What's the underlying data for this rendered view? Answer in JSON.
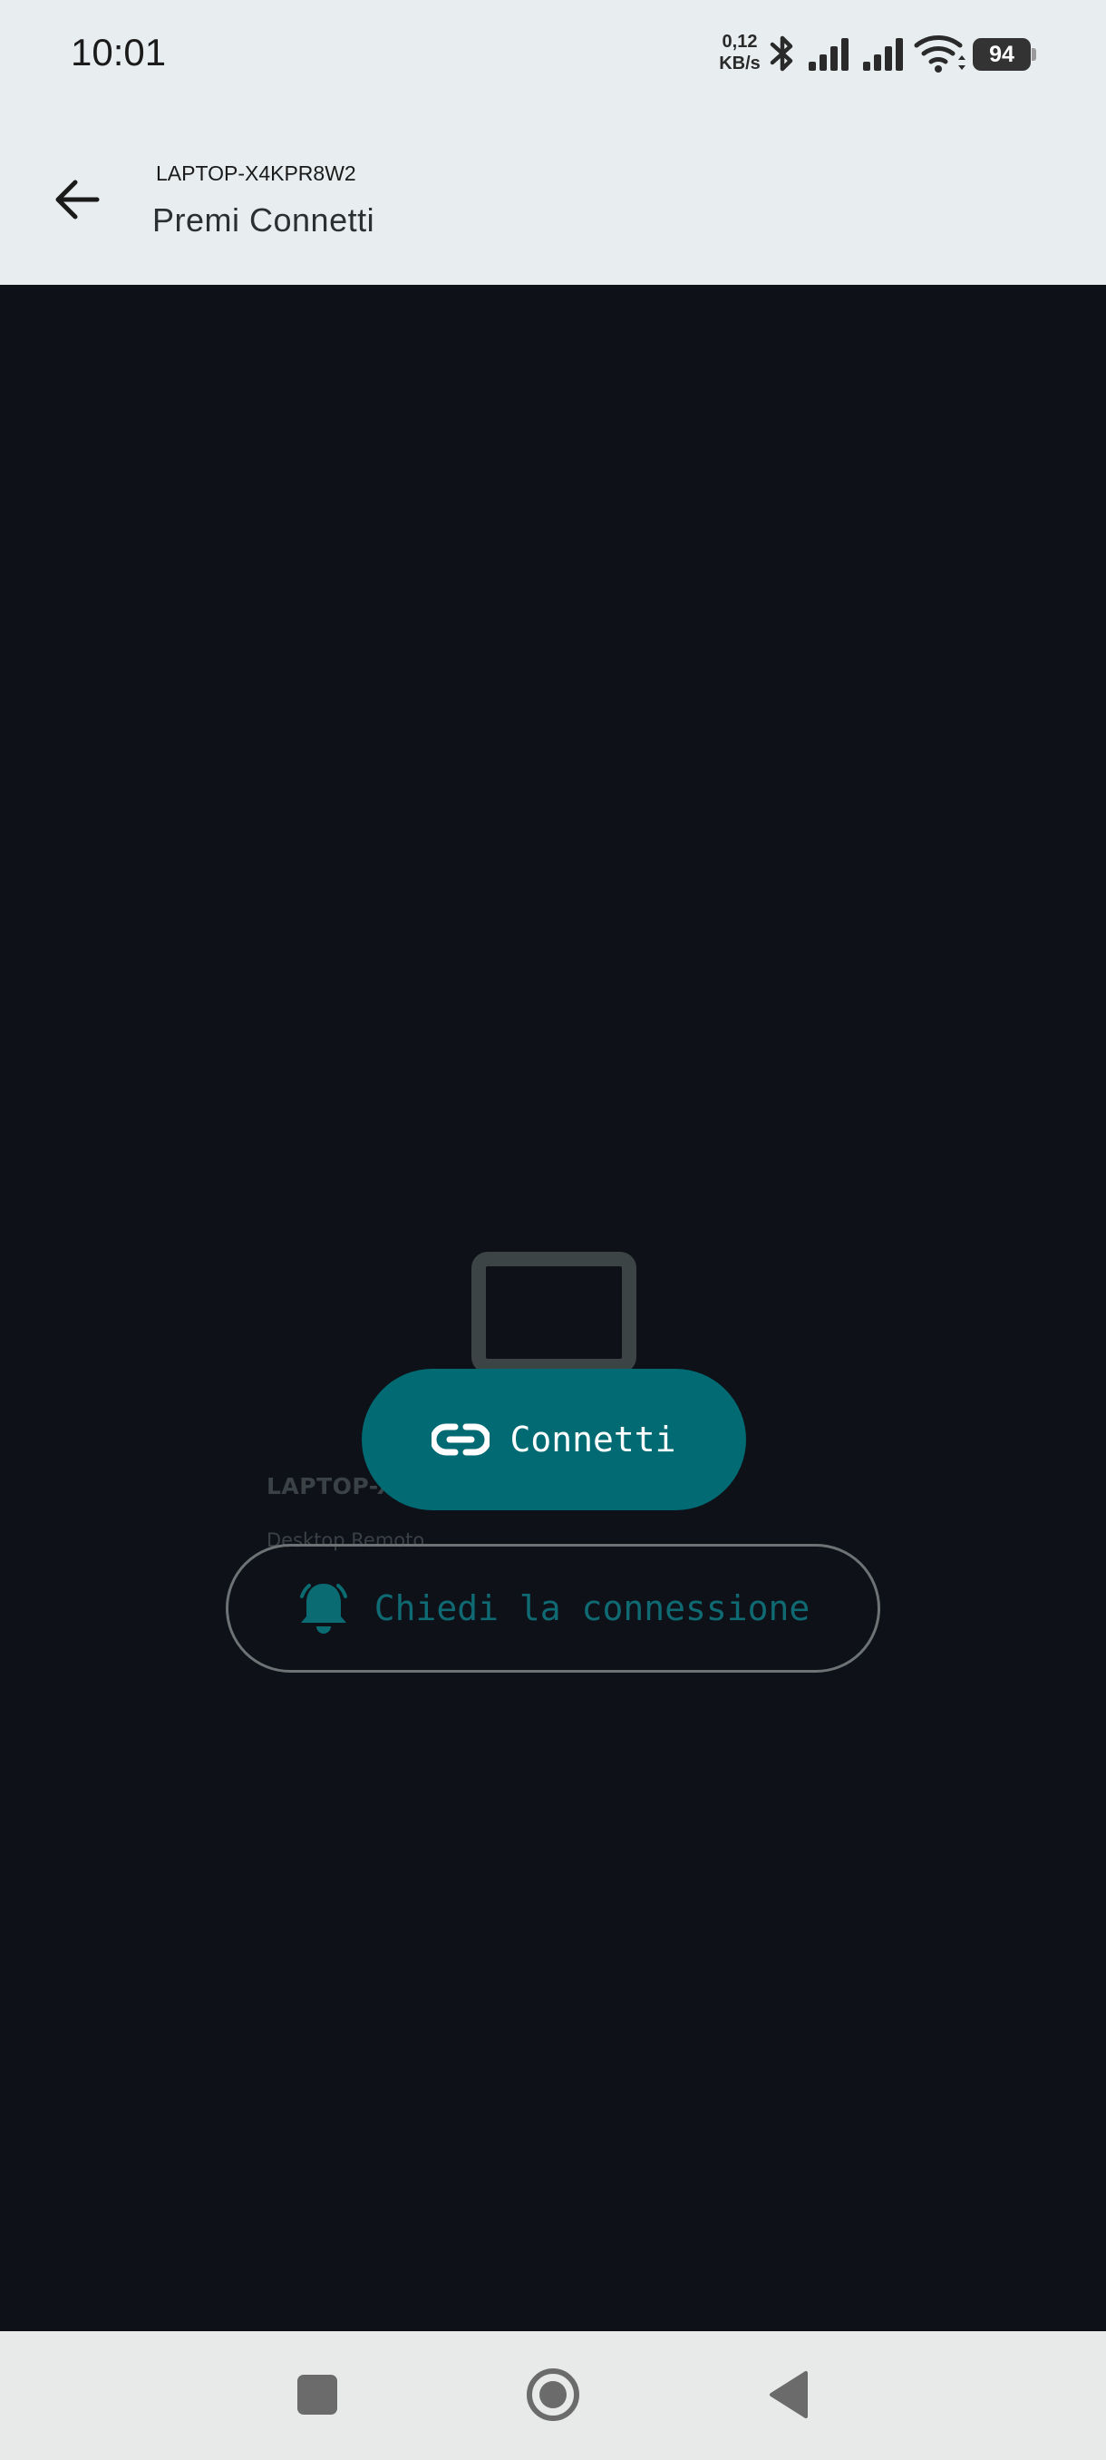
{
  "status_bar": {
    "time": "10:01",
    "net_speed_value": "0,12",
    "net_speed_unit": "KB/s",
    "battery_level": "94"
  },
  "app_bar": {
    "subtitle": "LAPTOP-X4KPR8W2",
    "title": "Premi Connetti"
  },
  "device": {
    "name": "LAPTOP-X4KPR8W2",
    "type": "Desktop Remoto"
  },
  "actions": {
    "connect_label": "Connetti",
    "request_label": "Chiedi la connessione"
  },
  "icons": [
    "back-arrow-icon",
    "monitor-icon",
    "link-icon",
    "bell-icon",
    "recents-icon",
    "home-icon",
    "back-icon"
  ],
  "colors": {
    "accent": "#016a72",
    "background": "#0e1117",
    "header": "#e8eeef"
  }
}
